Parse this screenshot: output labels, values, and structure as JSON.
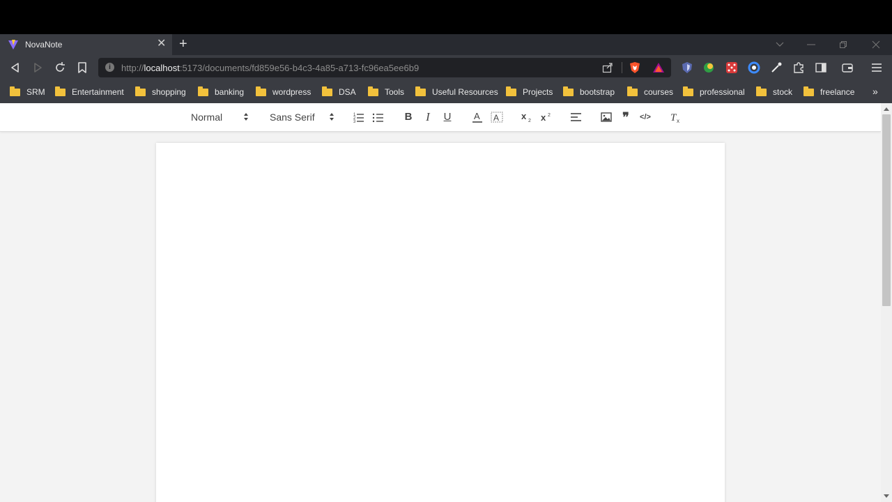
{
  "browser": {
    "tab": {
      "title": "NovaNote",
      "close_glyph": "✕",
      "favicon": "vite-logo-icon"
    },
    "new_tab_glyph": "+",
    "address": {
      "scheme": "http://",
      "host": "localhost",
      "rest": ":5173/documents/fd859e56-b4c3-4a85-a713-fc96ea5ee6b9"
    },
    "bookmarks": [
      "SRM",
      "Entertainment",
      "shopping",
      "banking",
      "wordpress",
      "DSA",
      "Tools",
      "Useful Resources",
      "Projects",
      "bootstrap",
      "courses",
      "professional",
      "stock",
      "freelance"
    ],
    "bookmarks_more": "»"
  },
  "editor": {
    "header_select": "Normal",
    "font_select": "Sans Serif",
    "buttons": {
      "bold": "B",
      "italic": "I",
      "underline": "U",
      "quote": "❞",
      "code": "</>"
    }
  },
  "colors": {
    "accent": "#3a3c42",
    "page_bg": "#f3f3f3",
    "folder": "#f2c13c"
  }
}
